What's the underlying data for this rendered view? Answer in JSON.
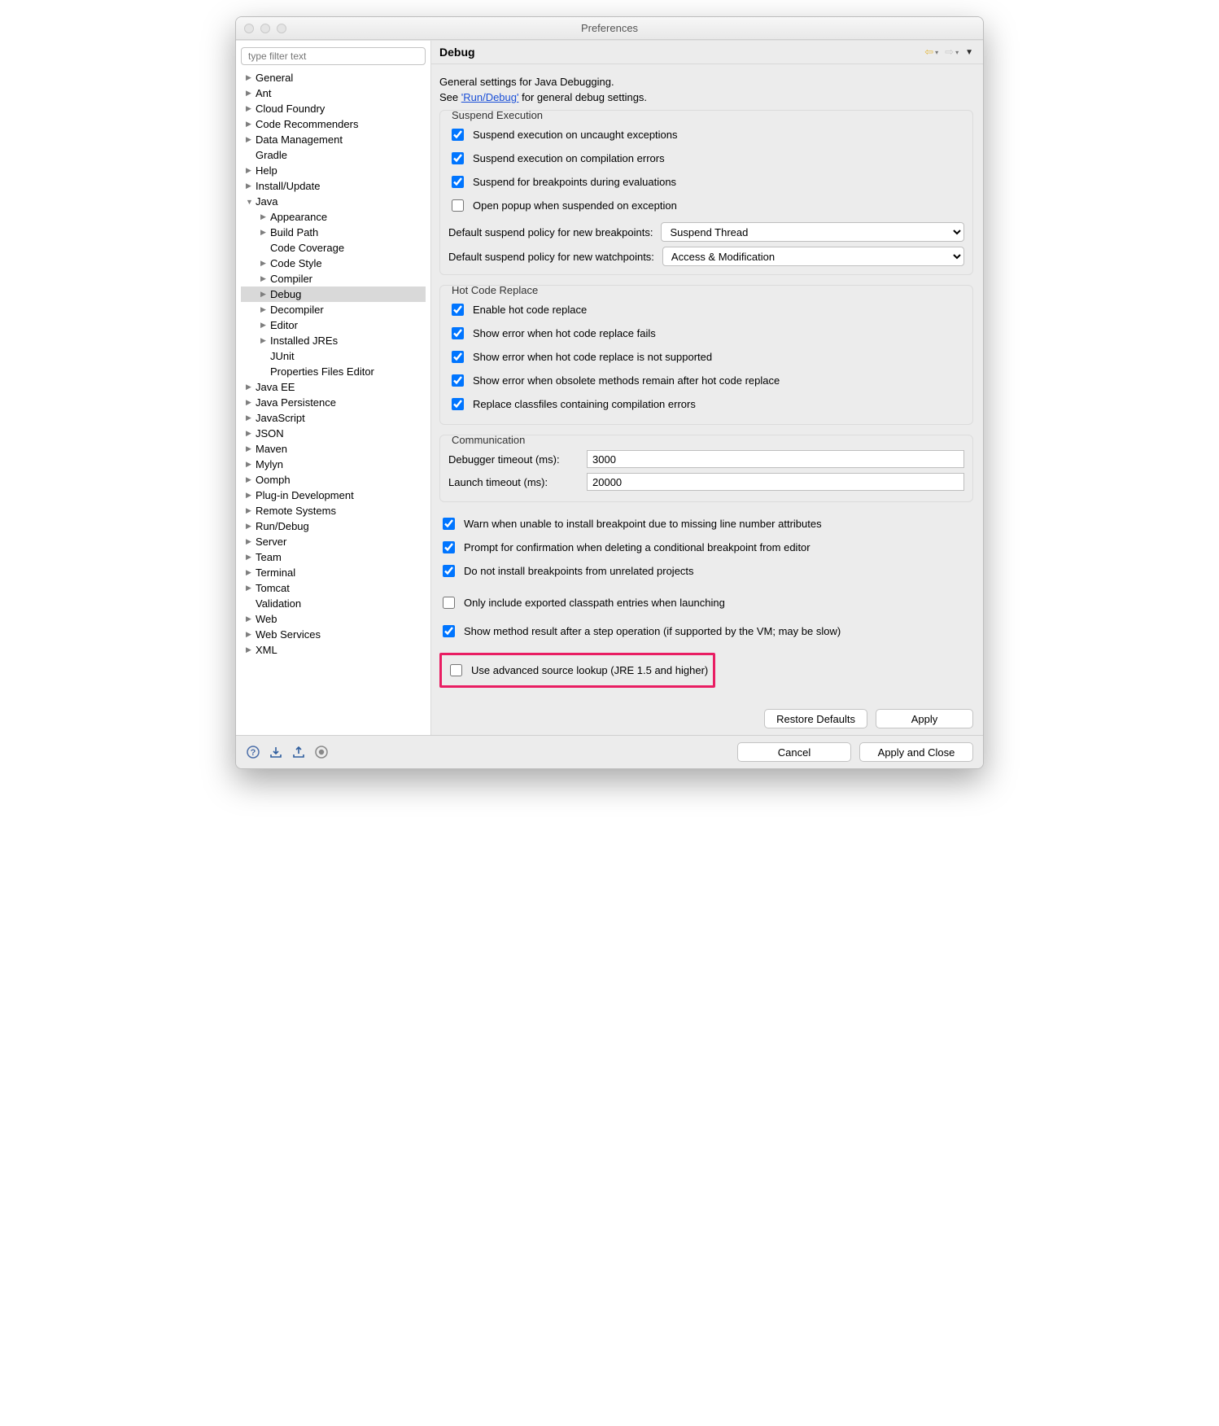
{
  "window": {
    "title": "Preferences"
  },
  "sidebar": {
    "filter_placeholder": "type filter text",
    "items": [
      {
        "label": "General",
        "tw": "▶",
        "depth": 0
      },
      {
        "label": "Ant",
        "tw": "▶",
        "depth": 0
      },
      {
        "label": "Cloud Foundry",
        "tw": "▶",
        "depth": 0
      },
      {
        "label": "Code Recommenders",
        "tw": "▶",
        "depth": 0
      },
      {
        "label": "Data Management",
        "tw": "▶",
        "depth": 0
      },
      {
        "label": "Gradle",
        "tw": "",
        "depth": 0
      },
      {
        "label": "Help",
        "tw": "▶",
        "depth": 0
      },
      {
        "label": "Install/Update",
        "tw": "▶",
        "depth": 0
      },
      {
        "label": "Java",
        "tw": "▼",
        "depth": 0
      },
      {
        "label": "Appearance",
        "tw": "▶",
        "depth": 1
      },
      {
        "label": "Build Path",
        "tw": "▶",
        "depth": 1
      },
      {
        "label": "Code Coverage",
        "tw": "",
        "depth": 1
      },
      {
        "label": "Code Style",
        "tw": "▶",
        "depth": 1
      },
      {
        "label": "Compiler",
        "tw": "▶",
        "depth": 1
      },
      {
        "label": "Debug",
        "tw": "▶",
        "depth": 1,
        "selected": true
      },
      {
        "label": "Decompiler",
        "tw": "▶",
        "depth": 1
      },
      {
        "label": "Editor",
        "tw": "▶",
        "depth": 1
      },
      {
        "label": "Installed JREs",
        "tw": "▶",
        "depth": 1
      },
      {
        "label": "JUnit",
        "tw": "",
        "depth": 1
      },
      {
        "label": "Properties Files Editor",
        "tw": "",
        "depth": 1
      },
      {
        "label": "Java EE",
        "tw": "▶",
        "depth": 0
      },
      {
        "label": "Java Persistence",
        "tw": "▶",
        "depth": 0
      },
      {
        "label": "JavaScript",
        "tw": "▶",
        "depth": 0
      },
      {
        "label": "JSON",
        "tw": "▶",
        "depth": 0
      },
      {
        "label": "Maven",
        "tw": "▶",
        "depth": 0
      },
      {
        "label": "Mylyn",
        "tw": "▶",
        "depth": 0
      },
      {
        "label": "Oomph",
        "tw": "▶",
        "depth": 0
      },
      {
        "label": "Plug-in Development",
        "tw": "▶",
        "depth": 0
      },
      {
        "label": "Remote Systems",
        "tw": "▶",
        "depth": 0
      },
      {
        "label": "Run/Debug",
        "tw": "▶",
        "depth": 0
      },
      {
        "label": "Server",
        "tw": "▶",
        "depth": 0
      },
      {
        "label": "Team",
        "tw": "▶",
        "depth": 0
      },
      {
        "label": "Terminal",
        "tw": "▶",
        "depth": 0
      },
      {
        "label": "Tomcat",
        "tw": "▶",
        "depth": 0
      },
      {
        "label": "Validation",
        "tw": "",
        "depth": 0
      },
      {
        "label": "Web",
        "tw": "▶",
        "depth": 0
      },
      {
        "label": "Web Services",
        "tw": "▶",
        "depth": 0
      },
      {
        "label": "XML",
        "tw": "▶",
        "depth": 0
      }
    ]
  },
  "page": {
    "title": "Debug",
    "intro1": "General settings for Java Debugging.",
    "intro2_pre": "See ",
    "intro2_link": "'Run/Debug'",
    "intro2_post": " for general debug settings.",
    "group_suspend": {
      "title": "Suspend Execution",
      "c1": "Suspend execution on uncaught exceptions",
      "c2": "Suspend execution on compilation errors",
      "c3": "Suspend for breakpoints during evaluations",
      "c4": "Open popup when suspended on exception",
      "bp_label": "Default suspend policy for new breakpoints:",
      "bp_value": "Suspend Thread",
      "wp_label": "Default suspend policy for new watchpoints:",
      "wp_value": "Access & Modification"
    },
    "group_hcr": {
      "title": "Hot Code Replace",
      "c1": "Enable hot code replace",
      "c2": "Show error when hot code replace fails",
      "c3": "Show error when hot code replace is not supported",
      "c4": "Show error when obsolete methods remain after hot code replace",
      "c5": "Replace classfiles containing compilation errors"
    },
    "group_comm": {
      "title": "Communication",
      "dbg_label": "Debugger timeout (ms):",
      "dbg_value": "3000",
      "lau_label": "Launch timeout (ms):",
      "lau_value": "20000"
    },
    "misc": {
      "c1": "Warn when unable to install breakpoint due to missing line number attributes",
      "c2": "Prompt for confirmation when deleting a conditional breakpoint from editor",
      "c3": "Do not install breakpoints from unrelated projects",
      "c4": "Only include exported classpath entries when launching",
      "c5": "Show method result after a step operation (if supported by the VM; may be slow)",
      "c6": "Use advanced source lookup (JRE 1.5 and higher)"
    },
    "buttons": {
      "restore": "Restore Defaults",
      "apply": "Apply",
      "cancel": "Cancel",
      "applyclose": "Apply and Close"
    }
  }
}
